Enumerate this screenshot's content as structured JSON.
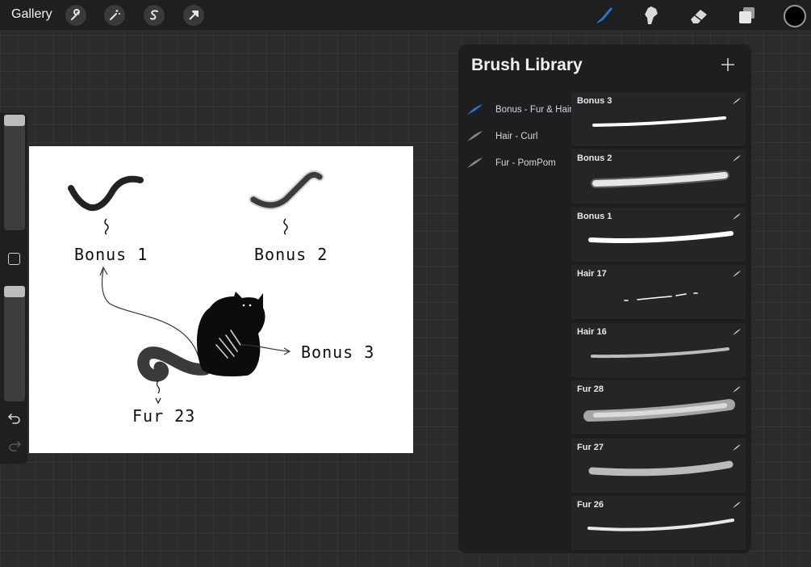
{
  "topbar": {
    "gallery_label": "Gallery",
    "left_tools": [
      "wrench-icon",
      "magic-wand-icon",
      "selection-s-icon",
      "transform-arrow-icon"
    ],
    "right_tools": [
      "brush-icon",
      "smudge-icon",
      "eraser-icon",
      "layers-icon"
    ],
    "active_tool": "brush-icon",
    "accent": "#1f7ae0",
    "current_color": "#000000"
  },
  "sidebar": {
    "size_level": 0.0,
    "opacity_level": 0.0,
    "modify_icon": "square-icon",
    "undo_icon": "undo-icon",
    "redo_icon": "redo-icon"
  },
  "canvas": {
    "labels": {
      "bonus1": "Bonus 1",
      "bonus2": "Bonus 2",
      "bonus3": "Bonus 3",
      "fur23": "Fur 23"
    }
  },
  "brush_library": {
    "title": "Brush Library",
    "add_icon": "plus-icon",
    "sets": [
      {
        "label": "Bonus - Fur & Hair",
        "active": true
      },
      {
        "label": "Hair - Curl",
        "active": false
      },
      {
        "label": "Fur - PomPom",
        "active": false
      }
    ],
    "brushes": [
      {
        "name": "Bonus 3"
      },
      {
        "name": "Bonus 2"
      },
      {
        "name": "Bonus 1"
      },
      {
        "name": "Hair 17"
      },
      {
        "name": "Hair 16"
      },
      {
        "name": "Fur 28"
      },
      {
        "name": "Fur 27"
      },
      {
        "name": "Fur 26"
      }
    ]
  }
}
